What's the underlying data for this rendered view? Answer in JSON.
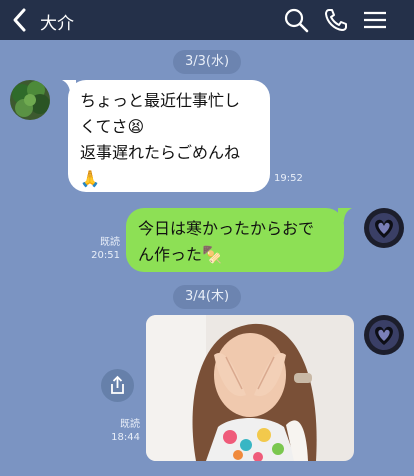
{
  "header": {
    "title": "大介",
    "back_icon": "chevron-left-icon",
    "search_icon": "search-icon",
    "call_icon": "phone-icon",
    "menu_icon": "hamburger-menu-icon"
  },
  "colors": {
    "header_bg": "#243049",
    "chat_bg": "#7b94c2",
    "outgoing_bubble": "#8de055",
    "incoming_bubble": "#ffffff"
  },
  "dates": {
    "first": "3/3(水)",
    "second": "3/4(木)"
  },
  "messages": {
    "incoming": {
      "line1": "ちょっと最近仕事忙し",
      "line2": "くてさ😫",
      "line3": "返事遅れたらごめんね",
      "line4": "🙏",
      "time": "19:52"
    },
    "outgoing": {
      "line1": "今日は寒かったからおで",
      "line2": "ん作った🍢",
      "read": "既読",
      "time": "20:51"
    },
    "photo": {
      "read": "既読",
      "time": "18:44",
      "share_icon": "share-icon"
    }
  }
}
